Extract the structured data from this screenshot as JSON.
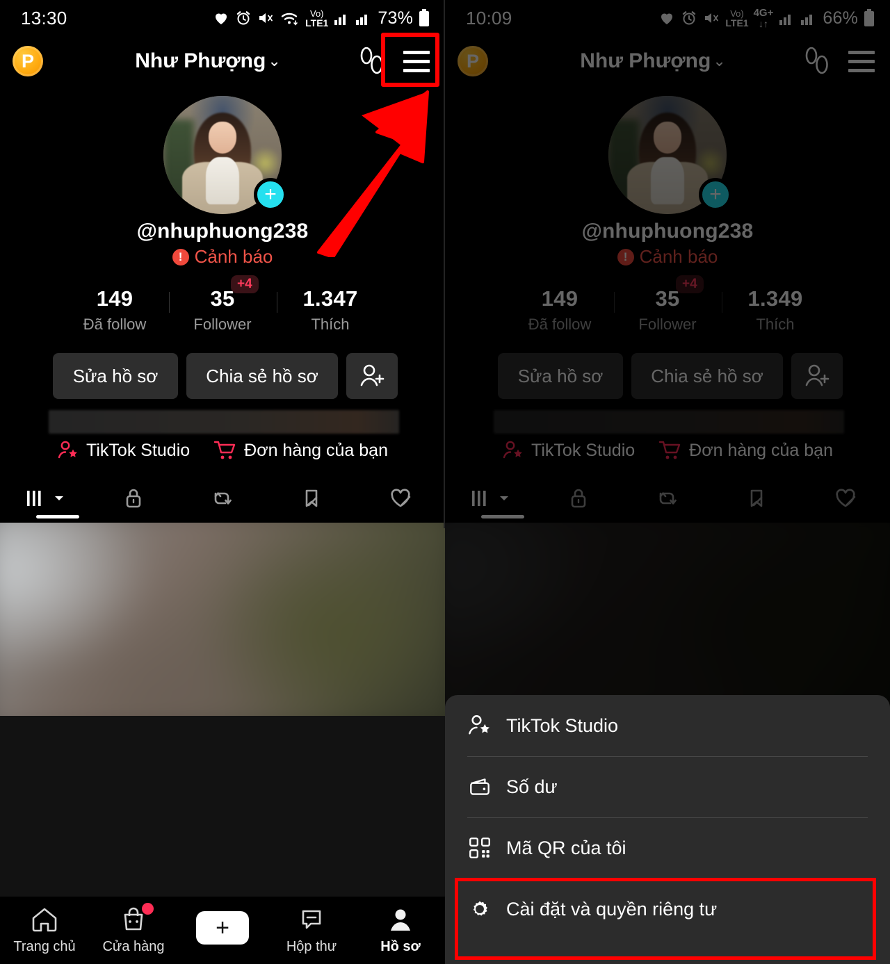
{
  "panels": {
    "left": {
      "status": {
        "time": "13:30",
        "battery": "73%",
        "network": "LTE1",
        "volte": "Vo)"
      },
      "header": {
        "coin_label": "P",
        "title": "Như Phượng",
        "chevron": "⌄"
      },
      "profile": {
        "username": "@nhuphuong238",
        "warning": "Cảnh báo",
        "warning_mark": "!",
        "plus": "+"
      },
      "stats": [
        {
          "num": "149",
          "label": "Đã follow",
          "badge": ""
        },
        {
          "num": "35",
          "label": "Follower",
          "badge": "+4"
        },
        {
          "num": "1.347",
          "label": "Thích",
          "badge": ""
        }
      ],
      "actions": {
        "edit": "Sửa hồ sơ",
        "share": "Chia sẻ hồ sơ"
      },
      "quicklinks": [
        {
          "label": "TikTok Studio"
        },
        {
          "label": "Đơn hàng của bạn"
        }
      ]
    },
    "right": {
      "status": {
        "time": "10:09",
        "battery": "66%",
        "network": "LTE1",
        "net2": "4G+",
        "volte": "Vo)"
      },
      "header": {
        "coin_label": "P",
        "title": "Như Phượng",
        "chevron": "⌄"
      },
      "profile": {
        "username": "@nhuphuong238",
        "warning": "Cảnh báo",
        "warning_mark": "!",
        "plus": "+"
      },
      "stats": [
        {
          "num": "149",
          "label": "Đã follow",
          "badge": ""
        },
        {
          "num": "35",
          "label": "Follower",
          "badge": "+4"
        },
        {
          "num": "1.349",
          "label": "Thích",
          "badge": ""
        }
      ],
      "actions": {
        "edit": "Sửa hồ sơ",
        "share": "Chia sẻ hồ sơ"
      },
      "quicklinks": [
        {
          "label": "TikTok Studio"
        },
        {
          "label": "Đơn hàng của bạn"
        }
      ]
    }
  },
  "bottom_nav": [
    {
      "label": "Trang chủ",
      "icon": "home-icon"
    },
    {
      "label": "Cửa hàng",
      "icon": "shop-icon"
    },
    {
      "label": "",
      "icon": "create-icon"
    },
    {
      "label": "Hộp thư",
      "icon": "inbox-icon"
    },
    {
      "label": "Hồ sơ",
      "icon": "profile-icon"
    }
  ],
  "overlay_menu": [
    {
      "label": "TikTok Studio",
      "icon": "studio-icon"
    },
    {
      "label": "Số dư",
      "icon": "wallet-icon"
    },
    {
      "label": "Mã QR của tôi",
      "icon": "qr-icon"
    },
    {
      "label": "Cài đặt và quyền riêng tư",
      "icon": "gear-icon"
    }
  ],
  "annotations": {
    "highlight_color": "#ff0000",
    "arrow": "red-arrow-up-right",
    "menu_button_box": "hamburger-highlight",
    "settings_box": "settings-highlight"
  },
  "colors": {
    "accent_red": "#fe2c55",
    "accent_cyan": "#25f4ee",
    "warning": "#f05449",
    "badge_text": "#ff3b5c",
    "sheet_bg": "#2c2c2c"
  }
}
